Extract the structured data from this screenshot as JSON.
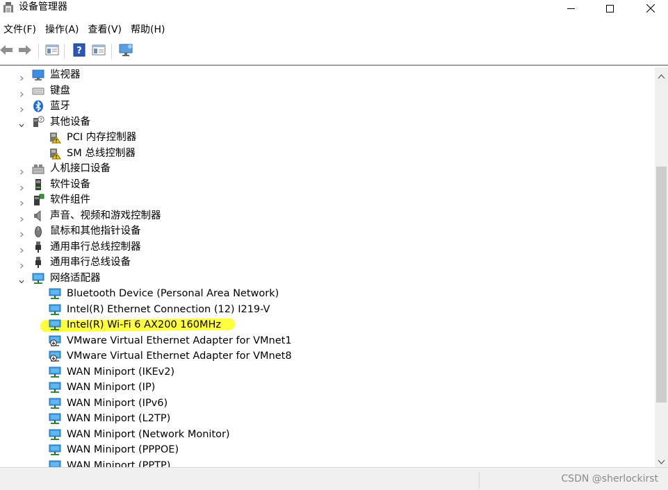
{
  "window": {
    "title": "设备管理器",
    "controls": {
      "minimize": "minimize-icon",
      "maximize": "maximize-icon",
      "close": "close-icon"
    }
  },
  "menu": [
    "文件(F)",
    "操作(A)",
    "查看(V)",
    "帮助(H)"
  ],
  "toolbar": [
    "back-arrow-icon",
    "forward-arrow-icon",
    "properties-icon",
    "help-icon",
    "view-icon",
    "monitor-icon"
  ],
  "tree": [
    {
      "label": "监视器",
      "level": 0,
      "expander": "collapsed",
      "icon": "monitor-icon"
    },
    {
      "label": "键盘",
      "level": 0,
      "expander": "collapsed",
      "icon": "keyboard-icon"
    },
    {
      "label": "蓝牙",
      "level": 0,
      "expander": "collapsed",
      "icon": "bluetooth-icon"
    },
    {
      "label": "其他设备",
      "level": 0,
      "expander": "expanded",
      "icon": "unknown-device-icon"
    },
    {
      "label": "PCI 内存控制器",
      "level": 1,
      "expander": "none",
      "icon": "warning-device-icon"
    },
    {
      "label": "SM 总线控制器",
      "level": 1,
      "expander": "none",
      "icon": "warning-device-icon"
    },
    {
      "label": "人机接口设备",
      "level": 0,
      "expander": "collapsed",
      "icon": "hid-icon"
    },
    {
      "label": "软件设备",
      "level": 0,
      "expander": "collapsed",
      "icon": "software-device-icon"
    },
    {
      "label": "软件组件",
      "level": 0,
      "expander": "collapsed",
      "icon": "software-component-icon"
    },
    {
      "label": "声音、视频和游戏控制器",
      "level": 0,
      "expander": "collapsed",
      "icon": "speaker-icon"
    },
    {
      "label": "鼠标和其他指针设备",
      "level": 0,
      "expander": "collapsed",
      "icon": "mouse-icon"
    },
    {
      "label": "通用串行总线控制器",
      "level": 0,
      "expander": "collapsed",
      "icon": "usb-icon"
    },
    {
      "label": "通用串行总线设备",
      "level": 0,
      "expander": "collapsed",
      "icon": "usb-icon"
    },
    {
      "label": "网络适配器",
      "level": 0,
      "expander": "expanded",
      "icon": "network-adapter-icon"
    },
    {
      "label": "Bluetooth Device (Personal Area Network)",
      "level": 1,
      "expander": "none",
      "icon": "network-adapter-icon"
    },
    {
      "label": "Intel(R) Ethernet Connection (12) I219-V",
      "level": 1,
      "expander": "none",
      "icon": "network-adapter-icon"
    },
    {
      "label": "Intel(R) Wi-Fi 6 AX200 160MHz",
      "level": 1,
      "expander": "none",
      "icon": "network-adapter-icon",
      "highlighted": true
    },
    {
      "label": "VMware Virtual Ethernet Adapter for VMnet1",
      "level": 1,
      "expander": "none",
      "icon": "disabled-network-adapter-icon"
    },
    {
      "label": "VMware Virtual Ethernet Adapter for VMnet8",
      "level": 1,
      "expander": "none",
      "icon": "disabled-network-adapter-icon"
    },
    {
      "label": "WAN Miniport (IKEv2)",
      "level": 1,
      "expander": "none",
      "icon": "network-adapter-icon"
    },
    {
      "label": "WAN Miniport (IP)",
      "level": 1,
      "expander": "none",
      "icon": "network-adapter-icon"
    },
    {
      "label": "WAN Miniport (IPv6)",
      "level": 1,
      "expander": "none",
      "icon": "network-adapter-icon"
    },
    {
      "label": "WAN Miniport (L2TP)",
      "level": 1,
      "expander": "none",
      "icon": "network-adapter-icon"
    },
    {
      "label": "WAN Miniport (Network Monitor)",
      "level": 1,
      "expander": "none",
      "icon": "network-adapter-icon"
    },
    {
      "label": "WAN Miniport (PPPOE)",
      "level": 1,
      "expander": "none",
      "icon": "network-adapter-icon"
    },
    {
      "label": "WAN Miniport (PPTP)",
      "level": 1,
      "expander": "none",
      "icon": "network-adapter-icon"
    }
  ],
  "statusbar": {
    "watermark": "CSDN @sherlockirst"
  },
  "colors": {
    "highlight": "#ffff3d",
    "scrollbar_thumb": "#cdcdcd",
    "statusbar": "#f0f0f0"
  }
}
